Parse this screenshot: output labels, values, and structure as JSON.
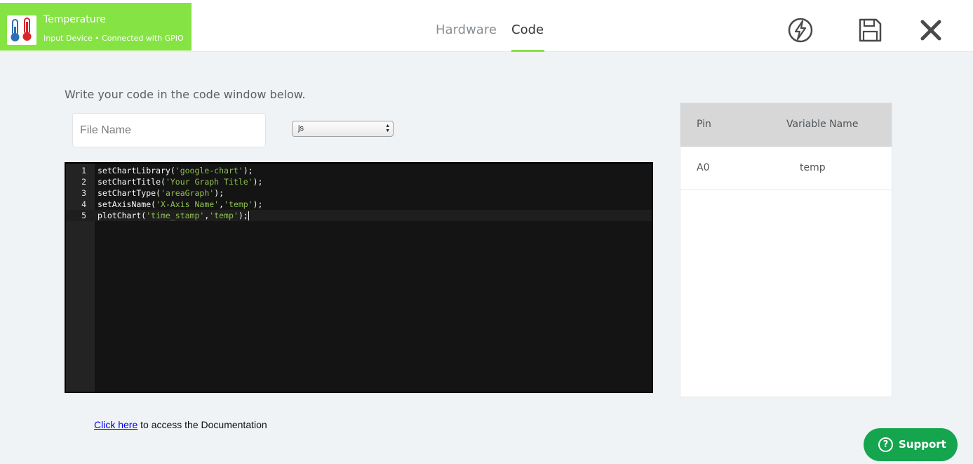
{
  "device": {
    "title": "Temperature",
    "subtitle": "Input Device • Connected with GPIO",
    "icon": "thermometer-icon"
  },
  "tabs": [
    {
      "label": "Hardware",
      "active": false
    },
    {
      "label": "Code",
      "active": true
    }
  ],
  "toolbar": {
    "flash_icon": "flash-icon",
    "save_icon": "save-icon",
    "close_icon": "close-icon"
  },
  "instructions": "Write your code in the code window below.",
  "file_name": {
    "value": "",
    "placeholder": "File Name"
  },
  "language": {
    "selected": "js"
  },
  "editor": {
    "lines": [
      {
        "number": "1",
        "parts": [
          {
            "t": "setChartLibrary(",
            "s": false
          },
          {
            "t": "'google-chart'",
            "s": true
          },
          {
            "t": ");",
            "s": false
          }
        ]
      },
      {
        "number": "2",
        "parts": [
          {
            "t": "setChartTitle(",
            "s": false
          },
          {
            "t": "'Your Graph Title'",
            "s": true
          },
          {
            "t": ");",
            "s": false
          }
        ]
      },
      {
        "number": "3",
        "parts": [
          {
            "t": "setChartType(",
            "s": false
          },
          {
            "t": "'areaGraph'",
            "s": true
          },
          {
            "t": ");",
            "s": false
          }
        ]
      },
      {
        "number": "4",
        "parts": [
          {
            "t": "setAxisName(",
            "s": false
          },
          {
            "t": "'X-Axis Name'",
            "s": true
          },
          {
            "t": ",",
            "s": false
          },
          {
            "t": "'temp'",
            "s": true
          },
          {
            "t": ");",
            "s": false
          }
        ]
      },
      {
        "number": "5",
        "parts": [
          {
            "t": "plotChart(",
            "s": false
          },
          {
            "t": "'time_stamp'",
            "s": true
          },
          {
            "t": ",",
            "s": false
          },
          {
            "t": "'temp'",
            "s": true
          },
          {
            "t": ");",
            "s": false
          }
        ]
      }
    ],
    "active_line": 5
  },
  "pin_table": {
    "headers": {
      "pin": "Pin",
      "variable": "Variable Name"
    },
    "rows": [
      {
        "pin": "A0",
        "variable": "temp"
      }
    ]
  },
  "documentation": {
    "link_text": "Click here",
    "rest": " to access the Documentation"
  },
  "support": {
    "label": "Support",
    "icon": "question-icon"
  },
  "colors": {
    "accent": "#86e344",
    "support": "#15a54f",
    "string": "#8fbf4f",
    "editor_bg": "#141414"
  }
}
